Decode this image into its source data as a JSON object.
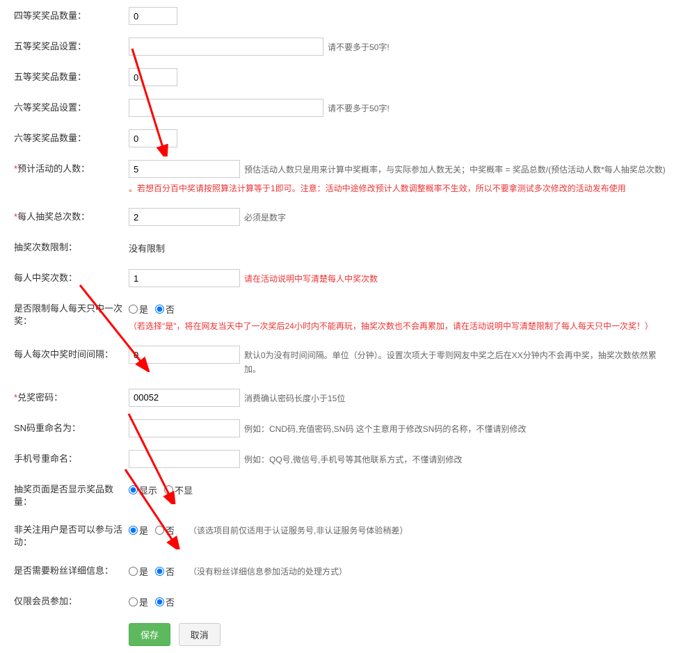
{
  "fields": {
    "prize4_qty": {
      "label": "四等奖奖品数量：",
      "value": "0"
    },
    "prize5_setup": {
      "label": "五等奖奖品设置：",
      "value": "",
      "hint": "请不要多于50字!"
    },
    "prize5_qty": {
      "label": "五等奖奖品数量：",
      "value": "0"
    },
    "prize6_setup": {
      "label": "六等奖奖品设置：",
      "value": "",
      "hint": "请不要多于50字!"
    },
    "prize6_qty": {
      "label": "六等奖奖品数量：",
      "value": "0"
    },
    "expected_people": {
      "label": "预计活动的人数：",
      "value": "5",
      "hint": "预估活动人数只是用来计算中奖概率，与实际参加人数无关；中奖概率 = 奖品总数/(预估活动人数*每人抽奖总次数)",
      "warn": "。若想百分百中奖请按照算法计算等于1即可。注意：活动中途修改预计人数调整概率不生效，所以不要拿测试多次修改的活动发布使用"
    },
    "draw_per_person": {
      "label": "每人抽奖总次数：",
      "value": "2",
      "hint": "必须是数字"
    },
    "draw_limit": {
      "label": "抽奖次数限制：",
      "value": "没有限制"
    },
    "win_per_person": {
      "label": "每人中奖次数：",
      "value": "1",
      "hint": "请在活动说明中写清楚每人中奖次数"
    },
    "daily_one_win": {
      "label": "是否限制每人每天只中一次奖：",
      "yes": "是",
      "no": "否",
      "paren": "（若选择\"是\"，将在网友当天中了一次奖后24小时内不能再玩，抽奖次数也不会再累加，请在活动说明中写清楚限制了每人每天只中一次奖！）"
    },
    "win_interval": {
      "label": "每人每次中奖时间间隔：",
      "value": "0",
      "hint": "默认0为没有时间间隔。单位（分钟）。设置次项大于零则网友中奖之后在XX分钟内不会再中奖，抽奖次数依然累加。"
    },
    "redeem_code": {
      "label": "兑奖密码：",
      "value": "00052",
      "hint": "消费确认密码长度小于15位"
    },
    "sn_rename": {
      "label": "SN码重命名为：",
      "value": "",
      "hint": "例如：CND码,充值密码,SN码 这个主意用于修改SN码的名称，不懂请别修改"
    },
    "phone_rename": {
      "label": "手机号重命名：",
      "value": "",
      "hint": "例如：QQ号,微信号,手机号等其他联系方式，不懂请别修改"
    },
    "show_prize_qty": {
      "label": "抽奖页面是否显示奖品数量：",
      "yes": "显示",
      "no": "不显"
    },
    "non_follow": {
      "label": "非关注用户是否可以参与活动：",
      "yes": "是",
      "no": "否",
      "paren": "（该选项目前仅适用于认证服务号,非认证服务号体验稍差）"
    },
    "need_fan_info": {
      "label": "是否需要粉丝详细信息：",
      "yes": "是",
      "no": "否",
      "paren": "（没有粉丝详细信息参加活动的处理方式）"
    },
    "member_only": {
      "label": "仅限会员参加：",
      "yes": "是",
      "no": "否"
    }
  },
  "buttons": {
    "save": "保存",
    "cancel": "取消"
  }
}
